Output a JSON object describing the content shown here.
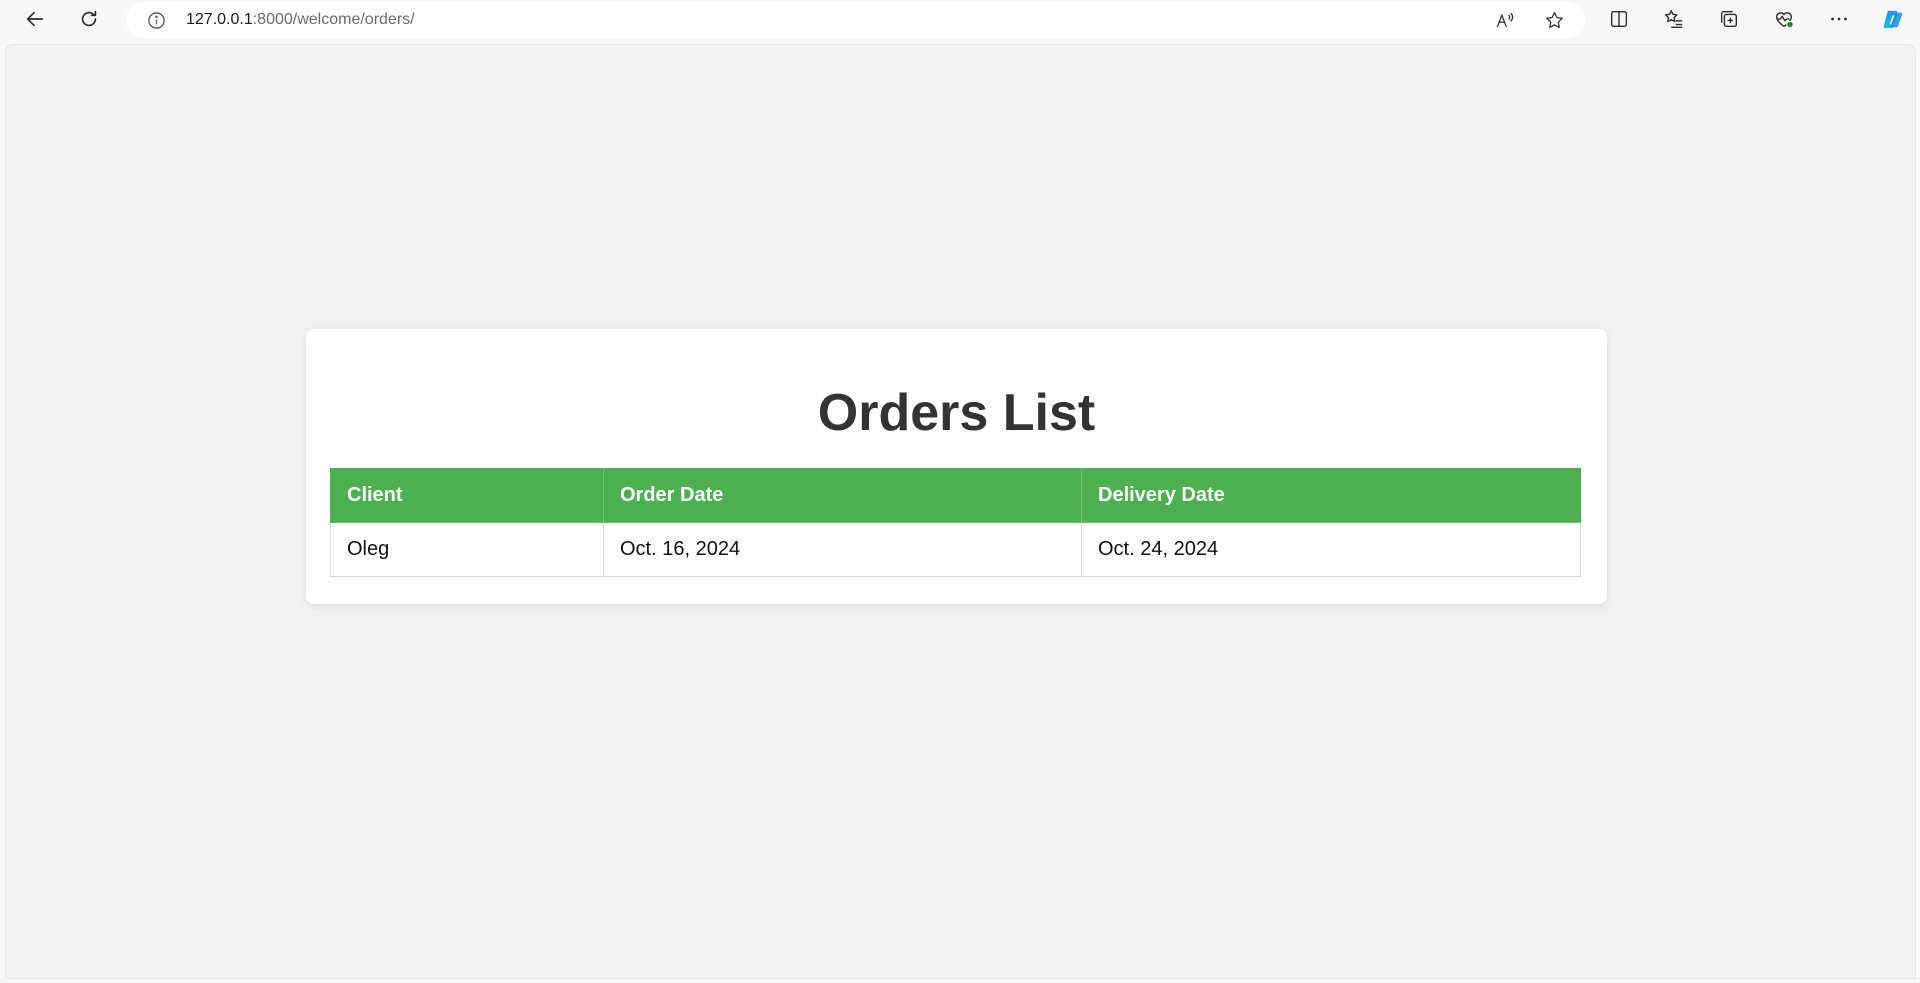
{
  "browser": {
    "url_host": "127.0.0.1",
    "url_path": ":8000/welcome/orders/",
    "icons": {
      "back": "back-arrow-icon",
      "reload": "reload-icon",
      "info": "site-info-icon",
      "read_aloud": "read-aloud-icon",
      "favorite": "star-icon",
      "split_screen": "split-screen-icon",
      "favorites": "favorites-list-icon",
      "collections": "collections-icon",
      "browser_essentials": "heart-pulse-icon",
      "more": "more-dots-icon",
      "copilot": "copilot-icon"
    }
  },
  "page": {
    "title": "Orders List",
    "table": {
      "headers": [
        "Client",
        "Order Date",
        "Delivery Date"
      ],
      "rows": [
        [
          "Oleg",
          "Oct. 16, 2024",
          "Oct. 24, 2024"
        ]
      ]
    }
  },
  "colors": {
    "header_green": "#4caf50",
    "page_background": "#f2f2f2",
    "card_background": "#ffffff",
    "title_color": "#333333"
  }
}
